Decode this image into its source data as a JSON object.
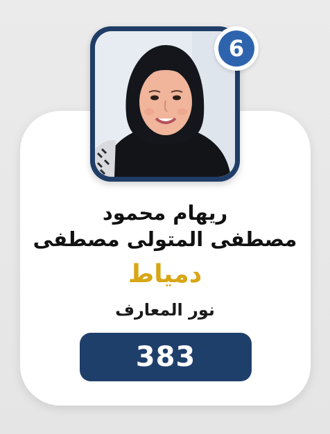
{
  "card": {
    "rank": "6",
    "name_line1": "ريهام محمود",
    "name_line2": "مصطفى المتولى مصطفى",
    "governorate": "دمياط",
    "school": "نور المعارف",
    "score": "383"
  },
  "colors": {
    "frame": "#1f3d66",
    "badge": "#2d64ad",
    "governorate_text": "#d8a514",
    "score_box": "#1f3f6b",
    "card_bg": "#ffffff",
    "page_bg": "#e8e8e8"
  }
}
